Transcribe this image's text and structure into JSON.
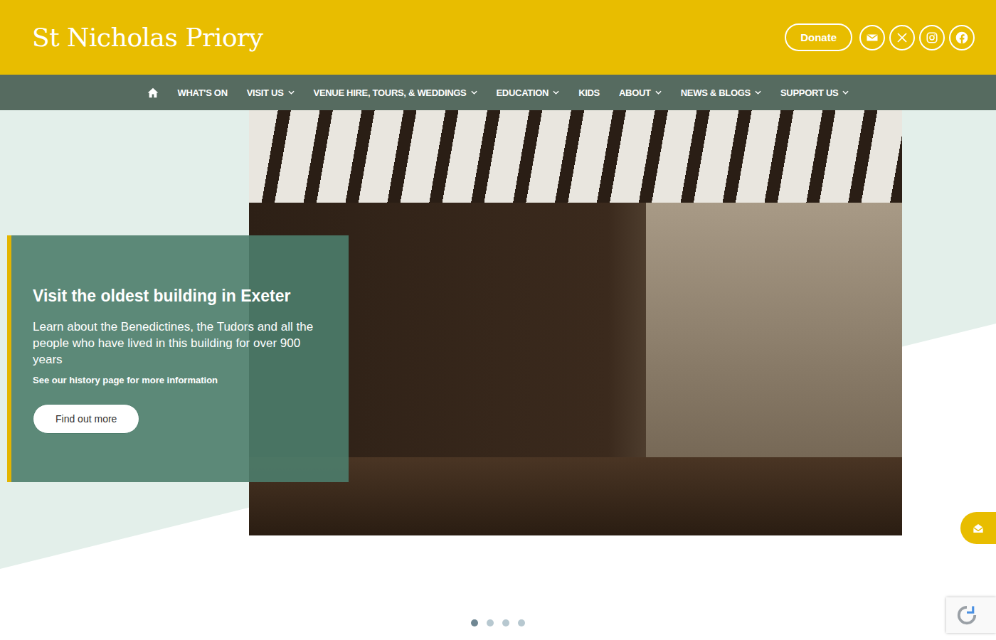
{
  "header": {
    "logo": "St Nicholas Priory",
    "donate": "Donate"
  },
  "nav": [
    {
      "label": "WHAT'S ON",
      "dropdown": false
    },
    {
      "label": "VISIT US",
      "dropdown": true
    },
    {
      "label": "VENUE HIRE, TOURS, & WEDDINGS",
      "dropdown": true
    },
    {
      "label": "EDUCATION",
      "dropdown": true
    },
    {
      "label": "KIDS",
      "dropdown": false
    },
    {
      "label": "ABOUT",
      "dropdown": true
    },
    {
      "label": "NEWS & BLOGS",
      "dropdown": true
    },
    {
      "label": "SUPPORT US",
      "dropdown": true
    }
  ],
  "slide": {
    "title": "Visit the oldest building in Exeter",
    "text": "Learn about the Benedictines, the Tudors and all the people who have lived in this building for over 900 years",
    "note": "See our history page for more information",
    "button": "Find out more"
  },
  "carousel": [
    {
      "selected": true
    },
    {
      "selected": false
    },
    {
      "selected": false
    },
    {
      "selected": false
    }
  ]
}
